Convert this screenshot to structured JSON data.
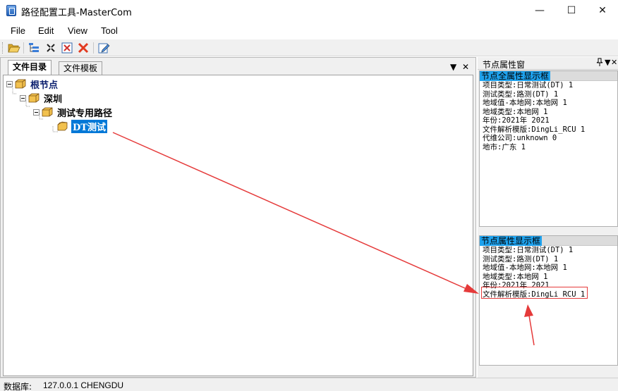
{
  "window": {
    "title": "路径配置工具-MasterCom",
    "minimize": "—",
    "maximize": "☐",
    "close": "✕"
  },
  "menu": [
    "File",
    "Edit",
    "View",
    "Tool"
  ],
  "toolbar": {
    "buttons": [
      "open-folder-icon",
      "tree-view-icon",
      "collapse-icon",
      "delete-box-icon",
      "delete-x-icon",
      "edit-icon"
    ]
  },
  "left_pane": {
    "tabs": [
      {
        "label": "文件目录",
        "active": true
      },
      {
        "label": "文件模板",
        "active": false
      }
    ],
    "tab_dropdown": "▼",
    "tab_close": "✕",
    "tree": [
      {
        "label": "根节点",
        "level": 0,
        "expander": true,
        "selected": false
      },
      {
        "label": "深圳",
        "level": 1,
        "expander": true,
        "selected": false
      },
      {
        "label": "测试专用路径",
        "level": 2,
        "expander": true,
        "selected": false
      },
      {
        "label": "DT测试",
        "level": 3,
        "expander": false,
        "selected": true
      }
    ]
  },
  "right_pane": {
    "title": "节点属性窗",
    "pin": "📌",
    "dropdown": "▼",
    "close": "✕",
    "panel_all": {
      "header": "节点全属性显示框",
      "lines": [
        "项目类型:日常测试(DT) 1",
        "测试类型:路测(DT) 1",
        "地域值-本地网:本地网 1",
        "地域类型:本地网 1",
        "年份:2021年 2021",
        "文件解析模版:DingLi_RCU 1",
        "代维公司:unknown 0",
        "地市:广东 1"
      ]
    },
    "panel_node": {
      "header": "节点属性显示框",
      "lines": [
        "项目类型:日常测试(DT) 1",
        "测试类型:路测(DT) 1",
        "地域值-本地网:本地网 1",
        "地域类型:本地网 1",
        "年份:2021年 2021",
        "文件解析模版:DingLi_RCU 1"
      ]
    }
  },
  "statusbar": {
    "label": "数据库:",
    "value": "127.0.0.1 CHENGDU"
  },
  "colors": {
    "selection": "#0078d7",
    "panel_header": "#1ea2ee",
    "annotation": "#e53a3a",
    "folder_box": "#e2a93a"
  }
}
